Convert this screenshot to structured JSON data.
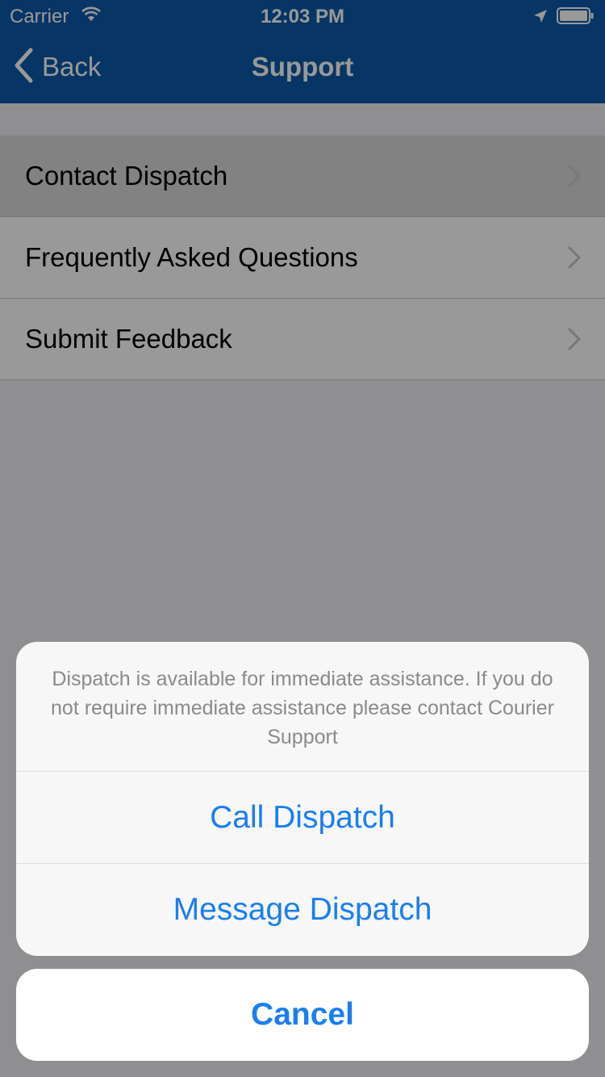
{
  "status_bar": {
    "carrier": "Carrier",
    "time": "12:03 PM",
    "icons": [
      "wifi-icon",
      "location-arrow-icon",
      "battery-icon"
    ]
  },
  "nav": {
    "back_label": "Back",
    "title": "Support",
    "background_color": "#0d59a8"
  },
  "menu": {
    "items": [
      {
        "label": "Contact Dispatch",
        "icon": "chevron-right-icon",
        "highlighted": true
      },
      {
        "label": "Frequently Asked Questions",
        "icon": "chevron-right-icon"
      },
      {
        "label": "Submit Feedback",
        "icon": "chevron-right-icon"
      }
    ]
  },
  "action_sheet": {
    "message": "Dispatch is available for immediate assistance. If you do not require immediate assistance please contact Courier Support",
    "actions": [
      {
        "label": "Call Dispatch"
      },
      {
        "label": "Message Dispatch"
      }
    ],
    "cancel_label": "Cancel",
    "action_color": "#1a7ef0"
  }
}
